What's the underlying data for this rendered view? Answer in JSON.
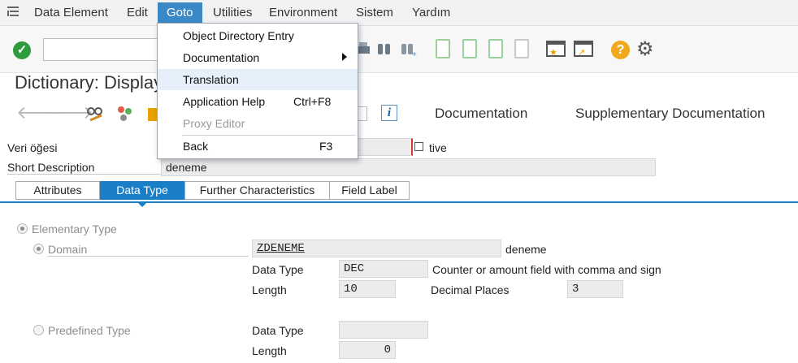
{
  "menubar": {
    "items": [
      "Data Element",
      "Edit",
      "Goto",
      "Utilities",
      "Environment",
      "Sistem",
      "Yardım"
    ]
  },
  "goto_menu": {
    "items": [
      {
        "label": "Object Directory Entry",
        "shortcut": ""
      },
      {
        "label": "Documentation",
        "shortcut": ""
      },
      {
        "label": "Translation",
        "shortcut": ""
      },
      {
        "label": "Application Help",
        "shortcut": "Ctrl+F8"
      },
      {
        "label": "Proxy Editor",
        "shortcut": ""
      },
      {
        "label": "Back",
        "shortcut": "F3"
      }
    ]
  },
  "page": {
    "title": "Dictionary: Display Data Element"
  },
  "appbar": {
    "documentation": "Documentation",
    "supplementary": "Supplementary Documentation",
    "info_icon": "i"
  },
  "header": {
    "data_element_label": "Veri öğesi",
    "data_element_value": "",
    "status_suffix": "tive",
    "short_desc_label": "Short Description",
    "short_desc_value": "deneme"
  },
  "tabs": [
    "Attributes",
    "Data Type",
    "Further Characteristics",
    "Field Label"
  ],
  "datatype": {
    "elementary_label": "Elementary Type",
    "domain_label": "Domain",
    "domain_value": "ZDENEME",
    "domain_desc": "deneme",
    "datatype_label": "Data Type",
    "datatype_value": "DEC",
    "datatype_desc": "Counter or amount field with comma and sign",
    "length_label": "Length",
    "length_value": "10",
    "decimal_label": "Decimal Places",
    "decimal_value": "3",
    "predefined_label": "Predefined Type",
    "predef_datatype_label": "Data Type",
    "predef_datatype_value": "",
    "predef_length_label": "Length",
    "predef_length_value": "0"
  },
  "colors": {
    "accent": "#1b7fc8",
    "menu_active": "#3a88c5",
    "ok_green": "#2e9b3c",
    "help_orange": "#f0a91d"
  }
}
